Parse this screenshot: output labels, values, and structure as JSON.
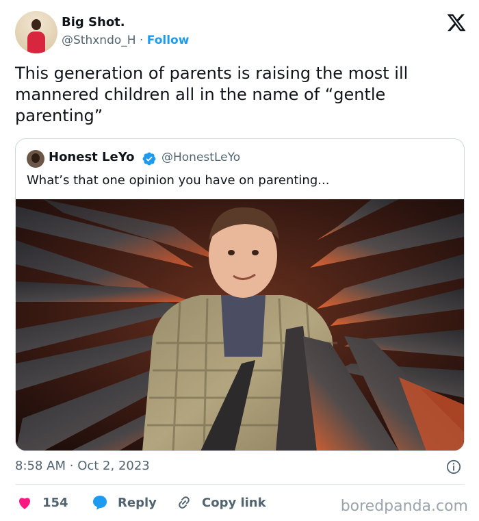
{
  "author": {
    "name": "Big Shot.",
    "handle": "@Sthxndo_H",
    "separator": "·",
    "follow_label": "Follow"
  },
  "tweet": {
    "text": "This generation of parents is raising the most ill mannered children all in the name of “gentle parenting”"
  },
  "quoted": {
    "name": "Honest LeYo",
    "handle": "@HonestLeYo",
    "text": "What’s that one opinion you have on parenting..."
  },
  "meta": {
    "time": "8:58 AM",
    "separator": "·",
    "date": "Oct 2, 2023"
  },
  "actions": {
    "likes": "154",
    "reply_label": "Reply",
    "copy_link_label": "Copy link"
  },
  "watermark": "boredpanda.com",
  "colors": {
    "accent": "#1d9bf0",
    "like": "#f91880",
    "secondary_text": "#536471"
  },
  "icons": {
    "logo": "x-logo-icon",
    "verified": "verified-badge-icon",
    "info": "info-icon",
    "like": "heart-icon",
    "reply": "speech-bubble-icon",
    "link": "link-icon"
  }
}
